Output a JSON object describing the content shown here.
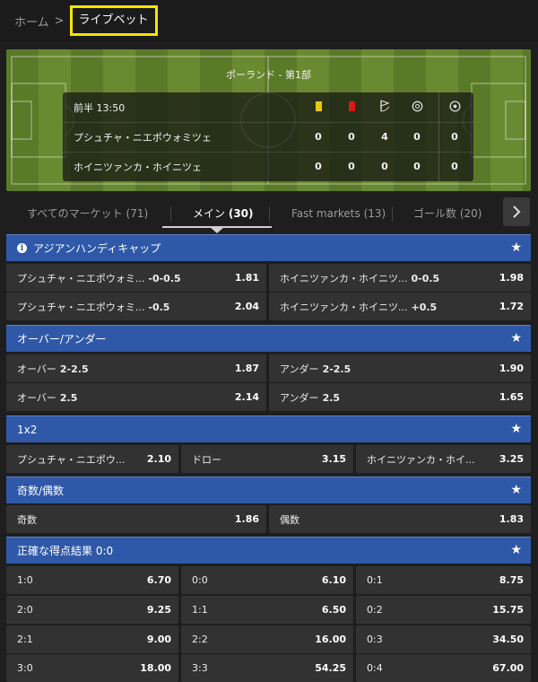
{
  "breadcrumb": {
    "home": "ホーム",
    "separator": ">",
    "current": "ライブベット"
  },
  "match": {
    "league": "ポーランド - 第1部",
    "period": "前半 13:50",
    "teams": [
      {
        "name": "プシュチャ・ニエポウォミツェ",
        "stats": [
          "0",
          "0",
          "4",
          "0",
          "0"
        ]
      },
      {
        "name": "ホイニツァンカ・ホイニツェ",
        "stats": [
          "0",
          "0",
          "0",
          "0",
          "0"
        ]
      }
    ],
    "stat_icons": [
      "yellow-card-icon",
      "red-card-icon",
      "corner-flag-icon",
      "penalty-icon",
      "goal-icon"
    ]
  },
  "tabs": [
    {
      "label": "すべてのマーケット",
      "count": "(71)"
    },
    {
      "label": "メイン",
      "count": "(30)"
    },
    {
      "label": "Fast markets",
      "count": "(13)"
    },
    {
      "label": "ゴール数",
      "count": "(20)"
    }
  ],
  "markets": {
    "asian": {
      "title": "アジアンハンディキャップ",
      "rows": [
        [
          {
            "name": "プシュチャ・ニエポウォミ...",
            "line": "-0-0.5",
            "price": "1.81"
          },
          {
            "name": "ホイニツァンカ・ホイニツ...",
            "line": "0-0.5",
            "price": "1.98"
          }
        ],
        [
          {
            "name": "プシュチャ・ニエポウォミ...",
            "line": "-0.5",
            "price": "2.04"
          },
          {
            "name": "ホイニツァンカ・ホイニツ...",
            "line": "+0.5",
            "price": "1.72"
          }
        ]
      ]
    },
    "overunder": {
      "title": "オーバー/アンダー",
      "rows": [
        [
          {
            "name": "オーバー",
            "line": "2-2.5",
            "price": "1.87"
          },
          {
            "name": "アンダー",
            "line": "2-2.5",
            "price": "1.90"
          }
        ],
        [
          {
            "name": "オーバー",
            "line": "2.5",
            "price": "2.14"
          },
          {
            "name": "アンダー",
            "line": "2.5",
            "price": "1.65"
          }
        ]
      ]
    },
    "x12": {
      "title": "1x2",
      "outcomes": [
        {
          "name": "プシュチャ・ニエポウ...",
          "price": "2.10"
        },
        {
          "name": "ドロー",
          "price": "3.15"
        },
        {
          "name": "ホイニツァンカ・ホイ...",
          "price": "3.25"
        }
      ]
    },
    "oddeven": {
      "title": "奇数/偶数",
      "outcomes": [
        {
          "name": "奇数",
          "price": "1.86"
        },
        {
          "name": "偶数",
          "price": "1.83"
        }
      ]
    },
    "correct": {
      "title": "正確な得点結果 0:0",
      "rows": [
        [
          {
            "name": "1:0",
            "price": "6.70"
          },
          {
            "name": "0:0",
            "price": "6.10"
          },
          {
            "name": "0:1",
            "price": "8.75"
          }
        ],
        [
          {
            "name": "2:0",
            "price": "9.25"
          },
          {
            "name": "1:1",
            "price": "6.50"
          },
          {
            "name": "0:2",
            "price": "15.75"
          }
        ],
        [
          {
            "name": "2:1",
            "price": "9.00"
          },
          {
            "name": "2:2",
            "price": "16.00"
          },
          {
            "name": "0:3",
            "price": "34.50"
          }
        ],
        [
          {
            "name": "3:0",
            "price": "18.00"
          },
          {
            "name": "3:3",
            "price": "54.25"
          },
          {
            "name": "0:4",
            "price": "67.00"
          }
        ]
      ]
    }
  },
  "colors": {
    "highlight": "#f6e400",
    "market_header": "#2f58a8",
    "odds_button": "#323232"
  }
}
